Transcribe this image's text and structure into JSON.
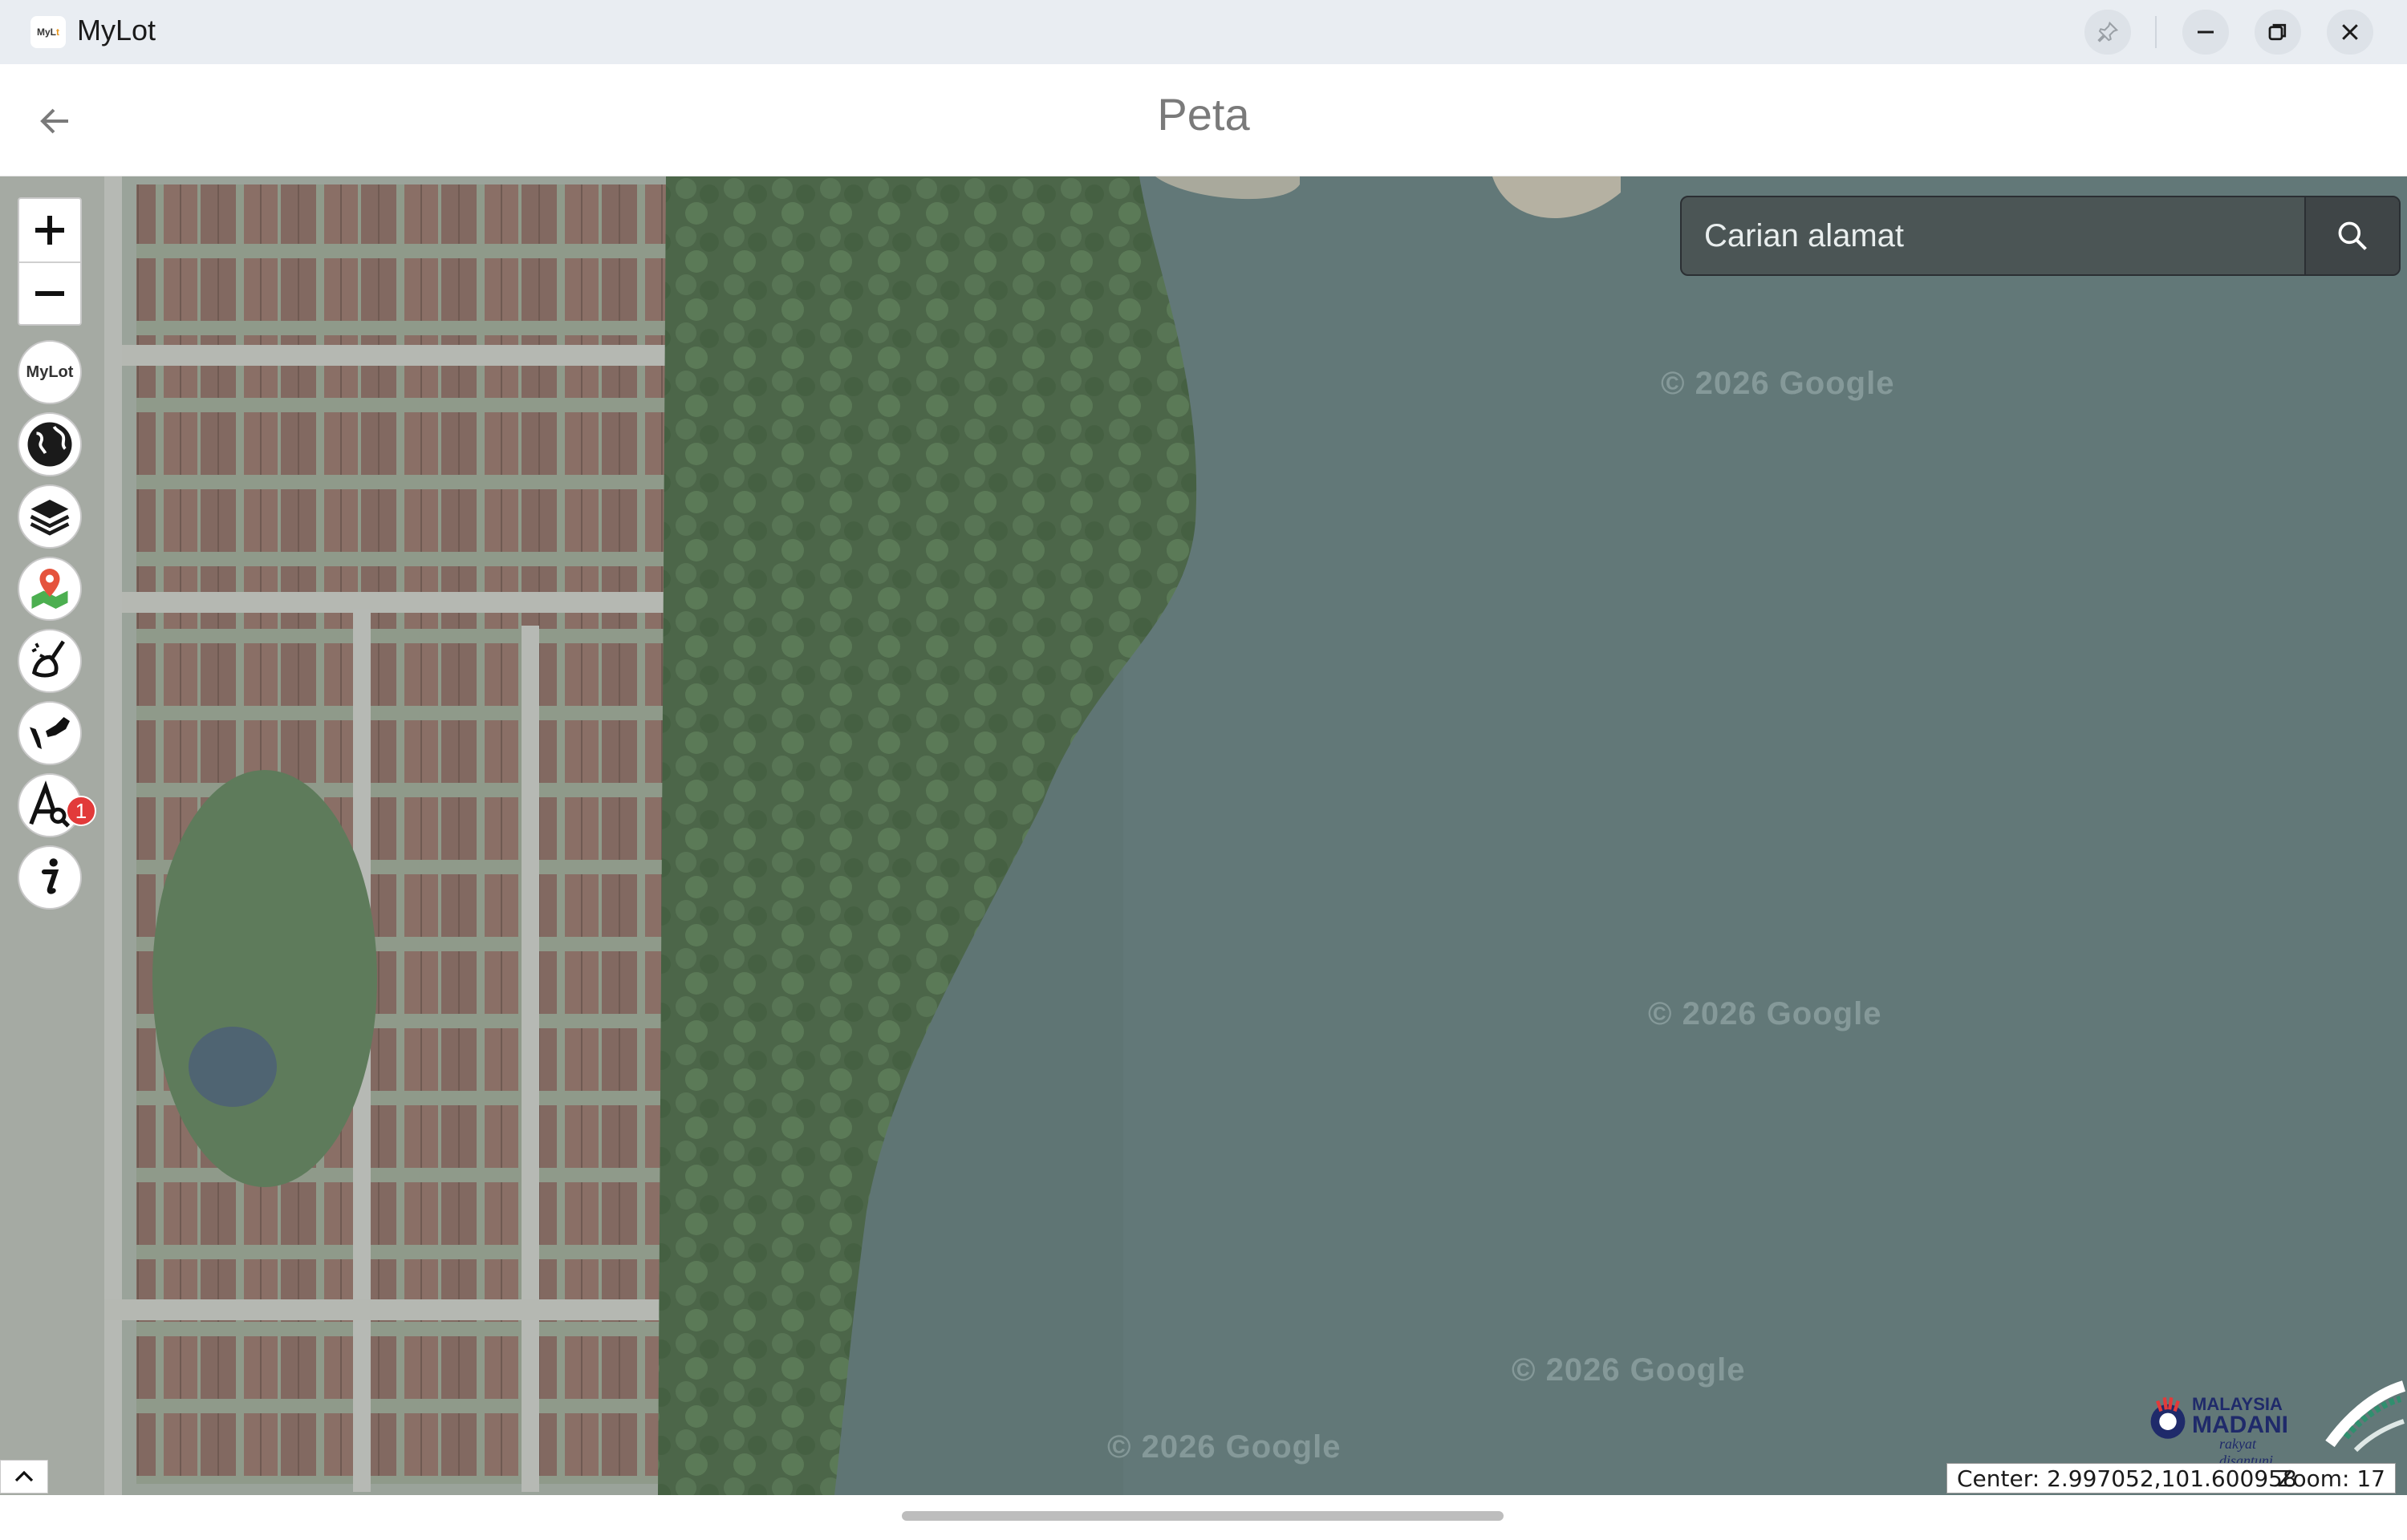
{
  "window": {
    "app_name": "MyLot",
    "icon_text_a": "MyL",
    "icon_text_b": "t",
    "icon_text_c": "t"
  },
  "header": {
    "title": "Peta"
  },
  "map": {
    "search": {
      "placeholder": "Carian alamat"
    },
    "watermark": "© 2026 Google",
    "tools": [
      {
        "name": "mylot-logo",
        "label": "MyLot"
      },
      {
        "name": "globe-icon"
      },
      {
        "name": "layers-icon"
      },
      {
        "name": "map-pin-icon"
      },
      {
        "name": "clear-brush-icon"
      },
      {
        "name": "malaysia-map-icon"
      },
      {
        "name": "font-search-icon"
      },
      {
        "name": "info-icon"
      }
    ],
    "badge": "1",
    "status": {
      "center": "Center: 2.997052,101.600958",
      "zoom": "Zoom: 17"
    },
    "logos": {
      "madani_line1": "MALAYSIA",
      "madani_line2": "MADANI",
      "madani_line3": "rakyat disantuni"
    },
    "colors": {
      "water": "#5f7574",
      "forest": "#4f6a4b",
      "roof": "#8a6f66"
    }
  }
}
